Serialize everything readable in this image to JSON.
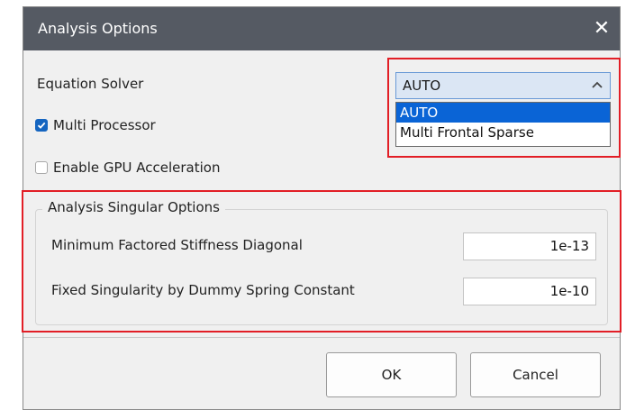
{
  "window": {
    "title": "Analysis Options",
    "close_glyph": "✕"
  },
  "equation_solver": {
    "label": "Equation Solver",
    "selected": "AUTO",
    "options": [
      "AUTO",
      "Multi Frontal Sparse"
    ],
    "expanded": true
  },
  "multi_processor": {
    "label": "Multi Processor",
    "checked": true
  },
  "gpu_acceleration": {
    "label": "Enable GPU Acceleration",
    "checked": false
  },
  "singular_options": {
    "legend": "Analysis Singular Options",
    "fields": [
      {
        "label": "Minimum Factored Stiffness Diagonal",
        "value": "1e-13"
      },
      {
        "label": "Fixed Singularity by Dummy Spring Constant",
        "value": "1e-10"
      }
    ]
  },
  "buttons": {
    "ok": "OK",
    "cancel": "Cancel"
  },
  "colors": {
    "titlebar": "#555a63",
    "highlight_border": "#e21e26",
    "selection": "#0a64d6",
    "checkbox_checked": "#1565c0"
  },
  "icons": {
    "close": "close-icon",
    "chevron": "chevron-up-icon",
    "check": "checkmark-icon"
  }
}
